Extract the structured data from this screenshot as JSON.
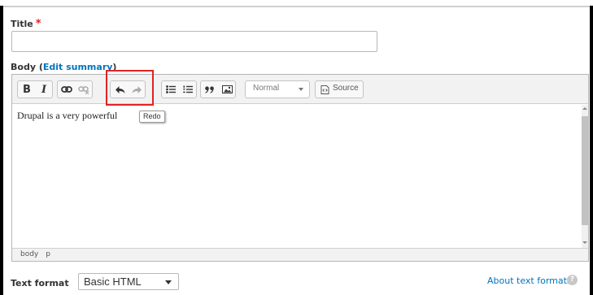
{
  "title_field": {
    "label": "Title",
    "required_mark": "*",
    "value": ""
  },
  "body_field": {
    "label_prefix": "Body (",
    "edit_summary_link": "Edit summary",
    "label_suffix": ")"
  },
  "toolbar": {
    "bold": "B",
    "italic": "I",
    "format_value": "Normal",
    "source_label": "Source"
  },
  "editor": {
    "content_text": "Drupal is a very powerful ",
    "tooltip": "Redo"
  },
  "path_bar": [
    "body",
    "p"
  ],
  "text_format": {
    "label": "Text format",
    "selected": "Basic HTML",
    "about_link": "About text formats",
    "help_glyph": "?"
  },
  "colors": {
    "accent_link": "#0074bd",
    "required": "#e02424",
    "highlight_box": "#e02424"
  },
  "icons": [
    "link-icon",
    "unlink-icon",
    "undo-icon",
    "redo-icon",
    "bulleted-list-icon",
    "numbered-list-icon",
    "blockquote-icon",
    "image-icon",
    "source-icon",
    "help-icon"
  ]
}
